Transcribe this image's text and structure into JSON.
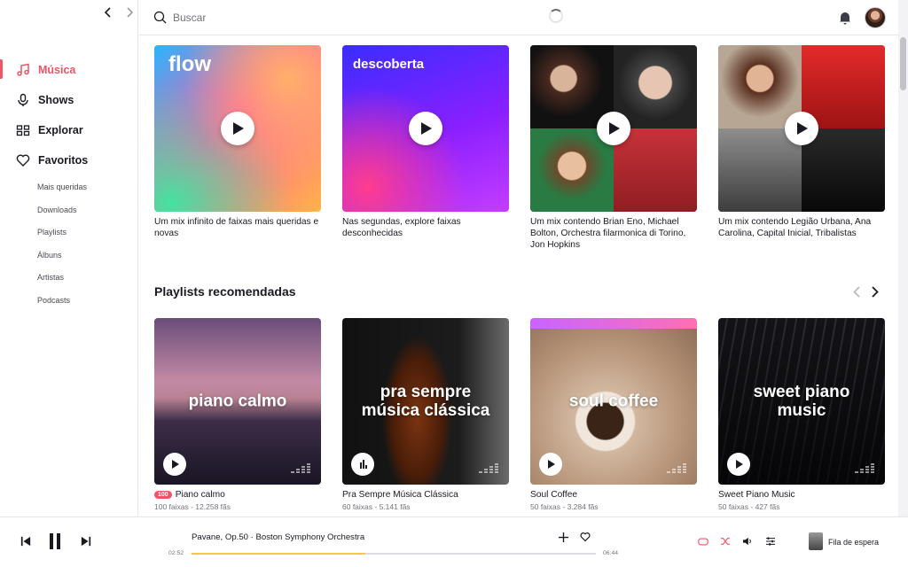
{
  "search": {
    "placeholder": "Buscar"
  },
  "sidebar": {
    "nav": [
      {
        "label": "Música",
        "icon": "music-note-icon",
        "active": true
      },
      {
        "label": "Shows",
        "icon": "microphone-icon",
        "active": false
      },
      {
        "label": "Explorar",
        "icon": "grid-icon",
        "active": false
      },
      {
        "label": "Favoritos",
        "icon": "heart-icon",
        "active": false
      }
    ],
    "sub": [
      "Mais queridas",
      "Downloads",
      "Playlists",
      "Álbuns",
      "Artistas",
      "Podcasts"
    ]
  },
  "mixes": [
    {
      "cover_title": "flow",
      "description": "Um mix infinito de faixas mais queridas e novas"
    },
    {
      "cover_title": "descoberta",
      "description": "Nas segundas, explore faixas desconhecidas"
    },
    {
      "cover_title": "",
      "description": "Um mix contendo Brian Eno, Michael Bolton, Orchestra filarmonica di Torino, Jon Hopkins"
    },
    {
      "cover_title": "",
      "description": "Um mix contendo Legião Urbana, Ana Carolina, Capital Inicial, Tribalistas"
    }
  ],
  "playlists_section": {
    "title": "Playlists recomendadas"
  },
  "playlists": [
    {
      "cover_title": "piano calmo",
      "name": "Piano calmo",
      "badge": "100",
      "meta": "100 faixas - 12.258 fãs"
    },
    {
      "cover_title": "pra sempre música clássica",
      "name": "Pra Sempre Música Clássica",
      "badge": "",
      "meta": "60 faixas - 5.141 fãs"
    },
    {
      "cover_title": "soul coffee",
      "name": "Soul Coffee",
      "badge": "",
      "meta": "50 faixas - 3.284 fãs"
    },
    {
      "cover_title": "sweet piano music",
      "name": "Sweet Piano Music",
      "badge": "",
      "meta": "50 faixas - 427 fãs"
    }
  ],
  "player": {
    "track": "Pavane, Op.50 · Boston Symphony Orchestra",
    "time_current": "02:52",
    "time_total": "06:44",
    "progress": 0.43,
    "queue_label": "Fila de espera"
  },
  "colors": {
    "accent": "#ef5466",
    "progress": "#f4c842"
  }
}
